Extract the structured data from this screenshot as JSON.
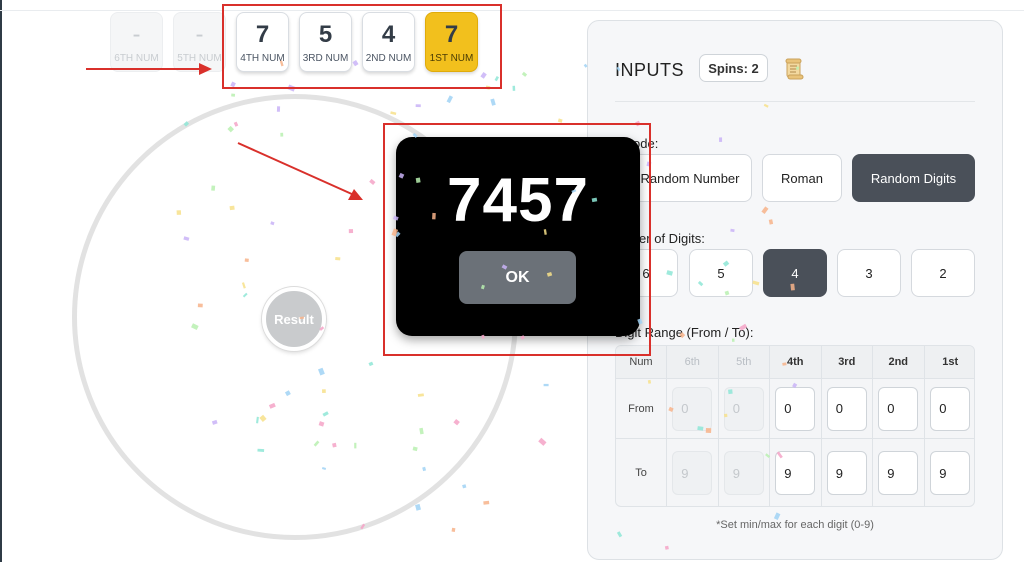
{
  "digits": [
    {
      "value": "-",
      "label": "6TH NUM",
      "state": "disabled"
    },
    {
      "value": "-",
      "label": "5TH NUM",
      "state": "disabled"
    },
    {
      "value": "7",
      "label": "4TH NUM",
      "state": "normal"
    },
    {
      "value": "5",
      "label": "3RD NUM",
      "state": "normal"
    },
    {
      "value": "4",
      "label": "2ND NUM",
      "state": "normal"
    },
    {
      "value": "7",
      "label": "1ST NUM",
      "state": "highlight"
    }
  ],
  "wheel": {
    "result_label": "Result"
  },
  "popup": {
    "number": "7457",
    "ok_label": "OK"
  },
  "panel": {
    "title": "INPUTS",
    "spins": "Spins: 2",
    "icon": "scroll-icon",
    "mode_label": "ode:",
    "modes": [
      "Random Number",
      "Roman",
      "Random Digits"
    ],
    "active_mode": "Random Digits",
    "digits_label": "mber of Digits:",
    "digit_counts": [
      "6",
      "5",
      "4",
      "3",
      "2"
    ],
    "active_count": "4",
    "range_label": "Digit Range (From / To):",
    "range_table": {
      "headers": [
        "Num",
        "6th",
        "5th",
        "4th",
        "3rd",
        "2nd",
        "1st"
      ],
      "from_label": "From",
      "to_label": "To",
      "from": [
        "0",
        "0",
        "0",
        "0",
        "0",
        "0"
      ],
      "to": [
        "9",
        "9",
        "9",
        "9",
        "9",
        "9"
      ]
    },
    "footnote": "*Set min/max for each digit (0-9)"
  },
  "colors": {
    "highlight": "#f2c01d",
    "active_button": "#4a5059",
    "annotation": "#d9302b",
    "popup_bg": "#000000"
  }
}
